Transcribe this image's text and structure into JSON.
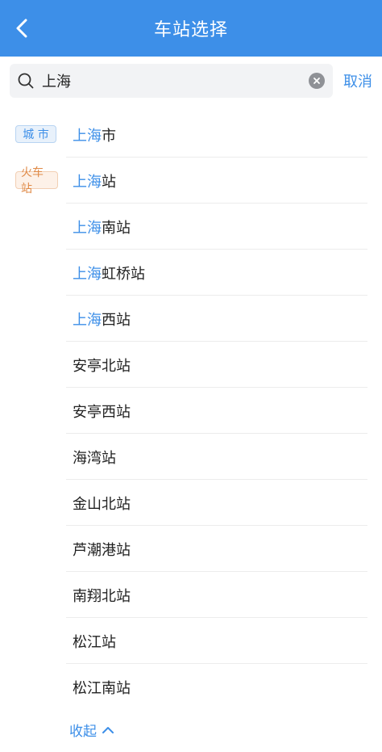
{
  "header": {
    "title": "车站选择"
  },
  "search": {
    "value": "上海",
    "cancel_label": "取消"
  },
  "results": {
    "city_badge": "城 市",
    "train_badge": "火车站",
    "city": {
      "highlight": "上海",
      "rest": "市"
    },
    "stations": [
      {
        "highlight": "上海",
        "rest": "站"
      },
      {
        "highlight": "上海",
        "rest": "南站"
      },
      {
        "highlight": "上海",
        "rest": "虹桥站"
      },
      {
        "highlight": "上海",
        "rest": "西站"
      },
      {
        "highlight": "",
        "rest": "安亭北站"
      },
      {
        "highlight": "",
        "rest": "安亭西站"
      },
      {
        "highlight": "",
        "rest": "海湾站"
      },
      {
        "highlight": "",
        "rest": "金山北站"
      },
      {
        "highlight": "",
        "rest": "芦潮港站"
      },
      {
        "highlight": "",
        "rest": "南翔北站"
      },
      {
        "highlight": "",
        "rest": "松江站"
      },
      {
        "highlight": "",
        "rest": "松江南站"
      }
    ],
    "collapse_label": "收起"
  }
}
